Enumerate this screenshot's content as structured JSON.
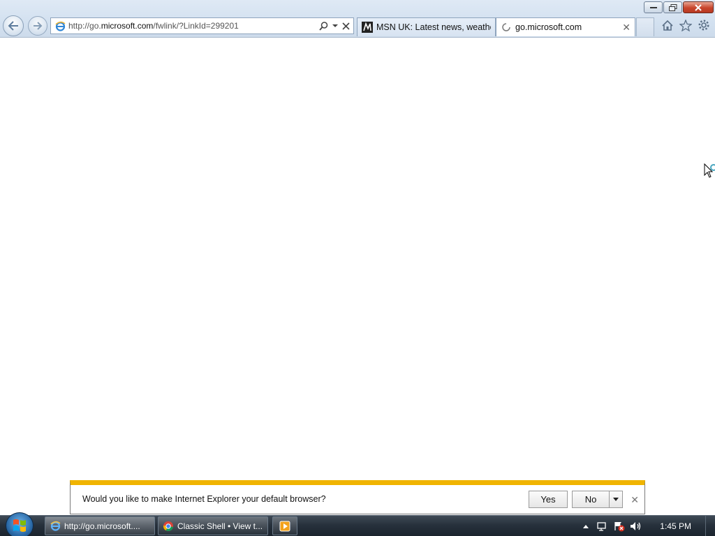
{
  "window": {
    "minimize_label": "minimize",
    "maximize_label": "restore",
    "close_label": "close"
  },
  "address_bar": {
    "url_prefix": "http://go.",
    "url_domain": "microsoft.com",
    "url_path": "/fwlink/?LinkId=299201"
  },
  "tabs": [
    {
      "title": "MSN UK: Latest news, weather...",
      "icon": "msn-icon"
    },
    {
      "title": "go.microsoft.com",
      "icon": "loading-icon",
      "close": "✕"
    }
  ],
  "notification": {
    "message": "Would you like to make Internet Explorer your default browser?",
    "yes_label": "Yes",
    "no_label": "No",
    "close": "✕",
    "accent_color": "#f0b400"
  },
  "taskbar": {
    "items": [
      {
        "label": "http://go.microsoft....",
        "icon": "ie-icon"
      },
      {
        "label": "Classic Shell • View t...",
        "icon": "chrome-icon"
      },
      {
        "label": "",
        "icon": "media-player-icon"
      }
    ],
    "clock": "1:45 PM"
  }
}
